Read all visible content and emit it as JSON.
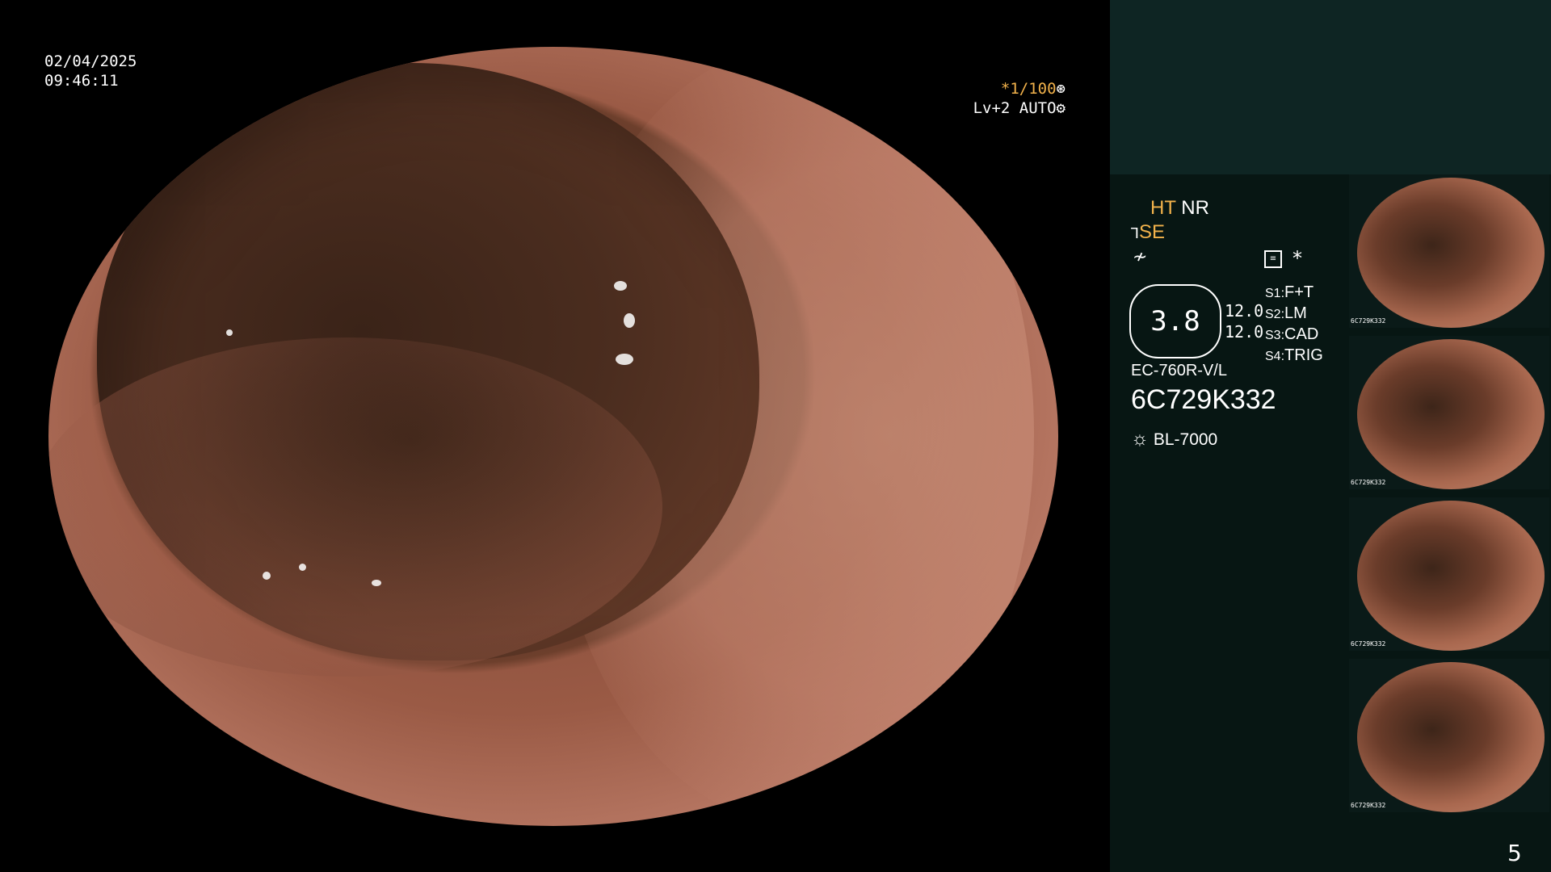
{
  "datetime": {
    "date": "02/04/2025",
    "time": "09:46:11"
  },
  "scope_settings": {
    "shutter": "*1/100",
    "shutter_icon": "aperture-icon",
    "level": "Lv+2",
    "mode": "AUTO",
    "mode_icon": "gear-icon"
  },
  "image_modes": {
    "ht": "HT",
    "nr": "NR",
    "se": "SE",
    "star": "*"
  },
  "zoom": {
    "ratio": "3.8",
    "value_1": "12.0",
    "value_2": "12.0"
  },
  "switch_assignments": [
    {
      "key": "S1",
      "value": "F+T"
    },
    {
      "key": "S2",
      "value": "LM"
    },
    {
      "key": "S3",
      "value": "CAD"
    },
    {
      "key": "S4",
      "value": "TRIG"
    }
  ],
  "device": {
    "scope_model": "EC-760R-V/L",
    "serial": "6C729K332",
    "light_source": "BL-7000"
  },
  "thumbnails": [
    {
      "label": "6C729K332"
    },
    {
      "label": "6C729K332"
    },
    {
      "label": "6C729K332"
    },
    {
      "label": "6C729K332"
    }
  ],
  "page_number": "5",
  "colors": {
    "accent": "#f2b24b",
    "panel_bg": "#071613",
    "panel_header_bg": "#0e2523"
  }
}
